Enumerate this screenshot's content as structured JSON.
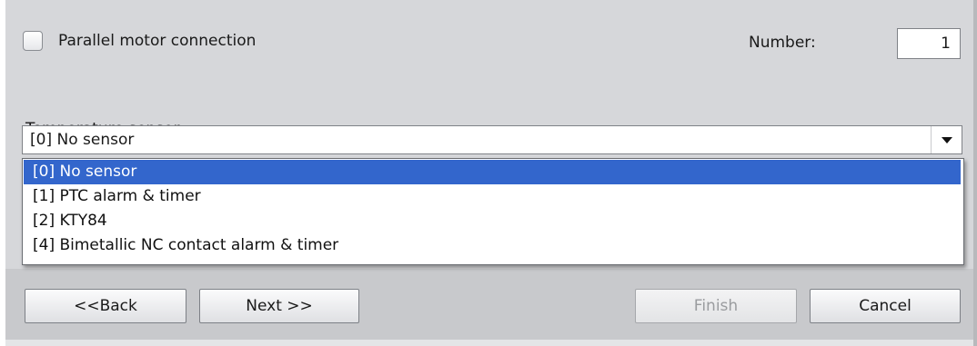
{
  "options_panel": {
    "parallel_motor_label": "Parallel motor connection",
    "parallel_motor_checked": false,
    "number_label": "Number:",
    "number_value": "1",
    "temperature_label": "Temperature sensor:",
    "temperature_selected": "[0] No sensor",
    "temperature_options": [
      "[0] No sensor",
      "[1] PTC alarm & timer",
      "[2] KTY84",
      "[4] Bimetallic NC contact alarm & timer"
    ]
  },
  "footer": {
    "back_label": "<<Back",
    "next_label": "Next >>",
    "finish_label": "Finish",
    "cancel_label": "Cancel"
  },
  "colors": {
    "panel_bg": "#d6d7da",
    "selection": "#3366cc"
  },
  "icons": {
    "dropdown": "chevron-down-icon"
  }
}
